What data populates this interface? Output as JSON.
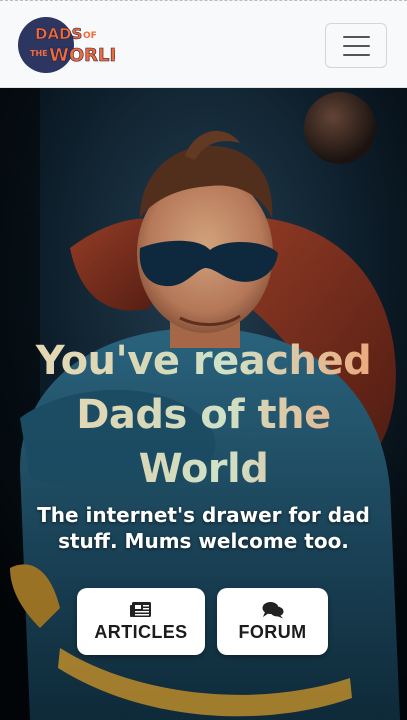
{
  "navbar": {
    "logo": {
      "line1": "DADS",
      "of": "OF",
      "line2": "THE",
      "line3": "WORLD",
      "circle_color": "#2d3561",
      "text_color": "#f26a3a"
    },
    "menu_icon": "hamburger-icon"
  },
  "hero": {
    "title": "You've reached Dads of the World",
    "subtitle": "The internet's drawer for dad stuff. Mums welcome too.",
    "buttons": [
      {
        "label": "ARTICLES",
        "icon": "newspaper-icon"
      },
      {
        "label": "FORUM",
        "icon": "comments-icon"
      }
    ]
  }
}
